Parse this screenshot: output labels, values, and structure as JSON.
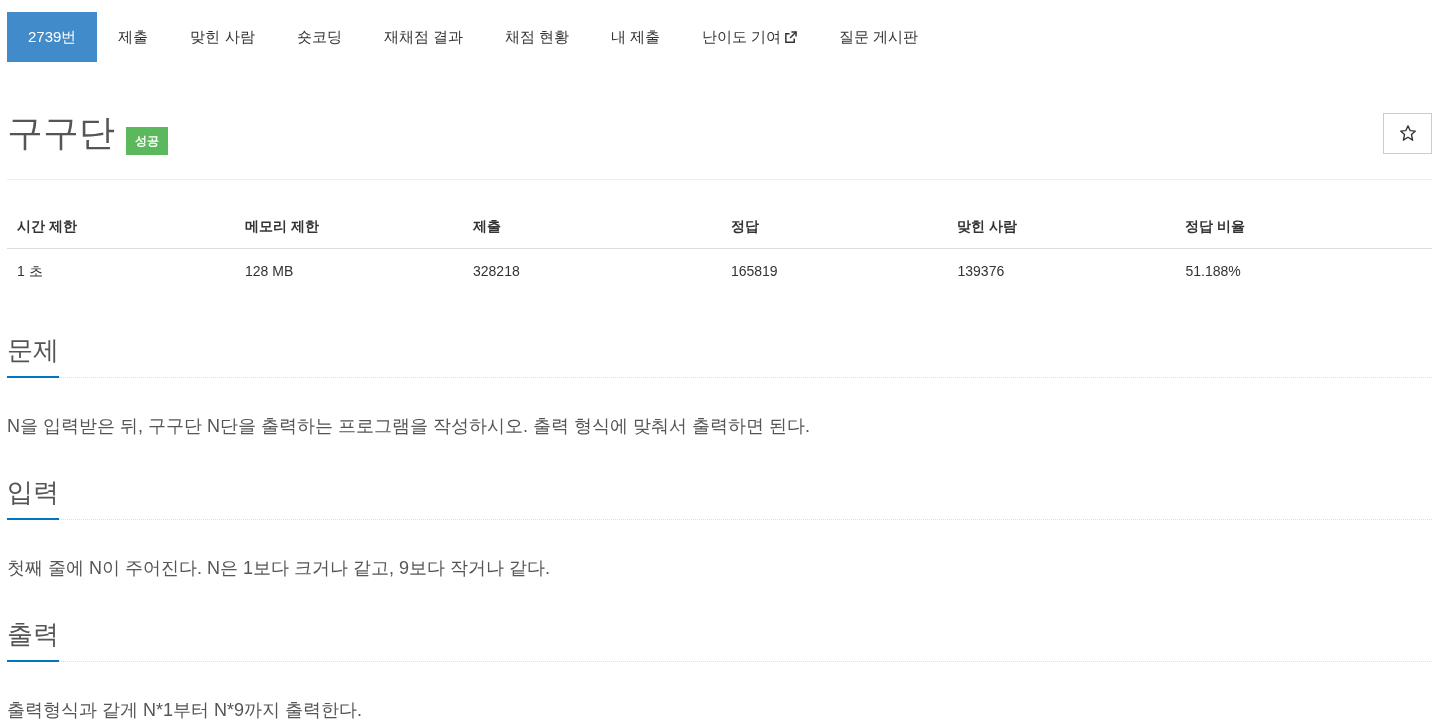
{
  "tabs": [
    {
      "label": "2739번",
      "selected": true,
      "external": false
    },
    {
      "label": "제출",
      "selected": false,
      "external": false
    },
    {
      "label": "맞힌 사람",
      "selected": false,
      "external": false
    },
    {
      "label": "숏코딩",
      "selected": false,
      "external": false
    },
    {
      "label": "재채점 결과",
      "selected": false,
      "external": false
    },
    {
      "label": "채점 현황",
      "selected": false,
      "external": false
    },
    {
      "label": "내 제출",
      "selected": false,
      "external": false
    },
    {
      "label": "난이도 기여",
      "selected": false,
      "external": true
    },
    {
      "label": "질문 게시판",
      "selected": false,
      "external": false
    }
  ],
  "problem": {
    "title": "구구단",
    "badge": "성공",
    "starred": false
  },
  "stats": {
    "columns": [
      "시간 제한",
      "메모리 제한",
      "제출",
      "정답",
      "맞힌 사람",
      "정답 비율"
    ],
    "rows": [
      [
        "1 초",
        "128 MB",
        "328218",
        "165819",
        "139376",
        "51.188%"
      ]
    ]
  },
  "sections": [
    {
      "heading": "문제",
      "text": "N을 입력받은 뒤, 구구단 N단을 출력하는 프로그램을 작성하시오. 출력 형식에 맞춰서 출력하면 된다."
    },
    {
      "heading": "입력",
      "text": "첫째 줄에 N이 주어진다. N은 1보다 크거나 같고, 9보다 작거나 같다."
    },
    {
      "heading": "출력",
      "text": "출력형식과 같게 N*1부터 N*9까지 출력한다."
    }
  ]
}
